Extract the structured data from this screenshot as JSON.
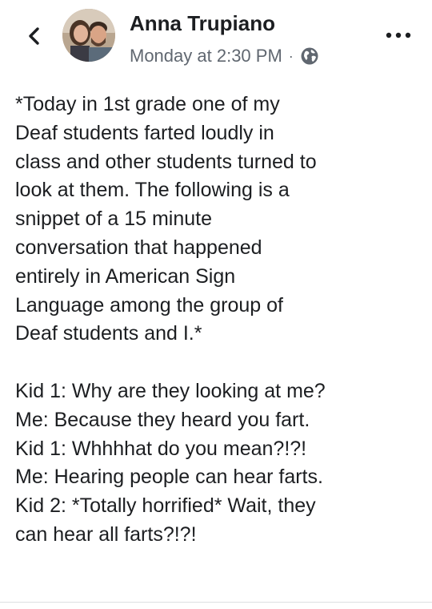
{
  "post": {
    "author": "Anna Trupiano",
    "timestamp": "Monday at 2:30 PM",
    "separator": "·",
    "privacy_icon": "globe-icon",
    "back_icon": "chevron-left-icon",
    "more_icon": "ellipsis-icon",
    "body_lines": [
      "*Today in 1st grade one of my",
      "Deaf students farted loudly in",
      "class and other students turned to",
      "look at them. The following is a",
      "snippet of a 15 minute",
      "conversation that happened",
      "entirely in American Sign",
      "Language among the group of",
      "Deaf students and I.*",
      "",
      "Kid 1: Why are they looking at me?",
      "Me: Because they heard you fart.",
      "Kid 1: Whhhhat do you mean?!?!",
      "Me: Hearing people can hear farts.",
      "Kid 2: *Totally horrified* Wait, they",
      "can hear all farts?!?!"
    ]
  },
  "colors": {
    "text": "#1c1e21",
    "secondary_text": "#606770",
    "background": "#ffffff"
  }
}
